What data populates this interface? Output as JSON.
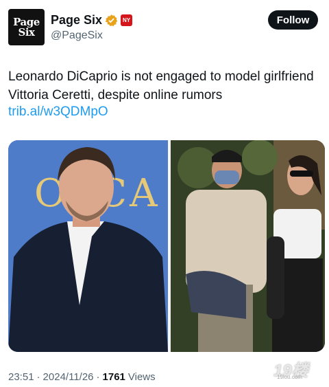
{
  "account": {
    "avatar_line1": "Page",
    "avatar_line2": "Six",
    "name": "Page Six",
    "handle": "@PageSix",
    "verified_icon": "verified-gold-check-icon",
    "affiliate_badge": "affiliate-badge-icon",
    "affiliate_text": "NY"
  },
  "follow_label": "Follow",
  "post": {
    "text": "Leonardo DiCaprio is not engaged to model girlfriend Vittoria Ceretti, despite online rumors",
    "link": "trib.al/w3QDMpO"
  },
  "media": {
    "left_backdrop_letters": "OSCA",
    "colors": {
      "left_bg": "#4d79c8",
      "right_bg": "#2f3a22"
    }
  },
  "meta": {
    "time": "23:51",
    "sep1": "·",
    "date": "2024/11/26",
    "sep2": "·",
    "views_count": "1761",
    "views_label": "Views"
  },
  "watermark": {
    "main": "19楼",
    "sub": "19lou.com"
  },
  "colors": {
    "link": "#1d9bf0",
    "text": "#0f1419",
    "muted": "#536471",
    "verified": "#e8a21c"
  }
}
